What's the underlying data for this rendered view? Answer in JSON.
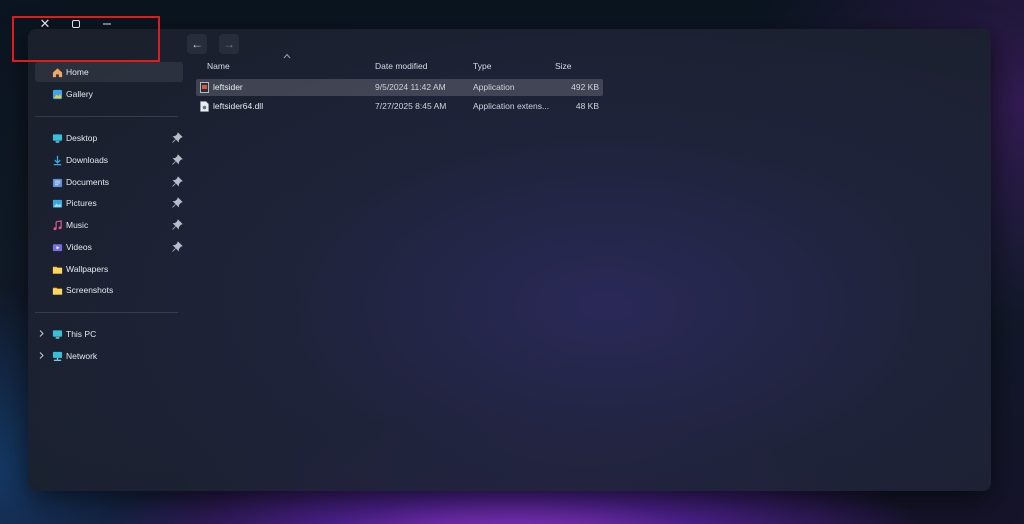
{
  "window_controls": {
    "close_glyph": "✕",
    "maximize_glyph": "☐",
    "minimize_glyph": "—"
  },
  "navigation": {
    "back_glyph": "←",
    "forward_glyph": "→"
  },
  "sidebar": {
    "items": [
      {
        "label": "Home",
        "icon": "home-icon",
        "active": true
      },
      {
        "label": "Gallery",
        "icon": "gallery-icon"
      },
      {
        "label": "Desktop",
        "icon": "desktop-icon",
        "pinned": true
      },
      {
        "label": "Downloads",
        "icon": "downloads-icon",
        "pinned": true
      },
      {
        "label": "Documents",
        "icon": "documents-icon",
        "pinned": true
      },
      {
        "label": "Pictures",
        "icon": "pictures-icon",
        "pinned": true
      },
      {
        "label": "Music",
        "icon": "music-icon",
        "pinned": true
      },
      {
        "label": "Videos",
        "icon": "videos-icon",
        "pinned": true
      },
      {
        "label": "Wallpapers",
        "icon": "folder-icon"
      },
      {
        "label": "Screenshots",
        "icon": "folder-icon"
      },
      {
        "label": "This PC",
        "icon": "this-pc-icon",
        "expandable": true
      },
      {
        "label": "Network",
        "icon": "network-icon",
        "expandable": true
      }
    ]
  },
  "file_list": {
    "columns": [
      "Name",
      "Date modified",
      "Type",
      "Size"
    ],
    "rows": [
      {
        "name": "leftsider",
        "date": "9/5/2024 11:42 AM",
        "type": "Application",
        "size": "492 KB",
        "selected": true,
        "icon": "application-icon"
      },
      {
        "name": "leftsider64.dll",
        "date": "7/27/2025 8:45 AM",
        "type": "Application extens...",
        "size": "48 KB",
        "icon": "dll-file-icon"
      }
    ]
  },
  "colors": {
    "highlight_box": "#e01b1b",
    "folder_yellow": "#f4c542",
    "accent_blue": "#3ba7e8"
  }
}
